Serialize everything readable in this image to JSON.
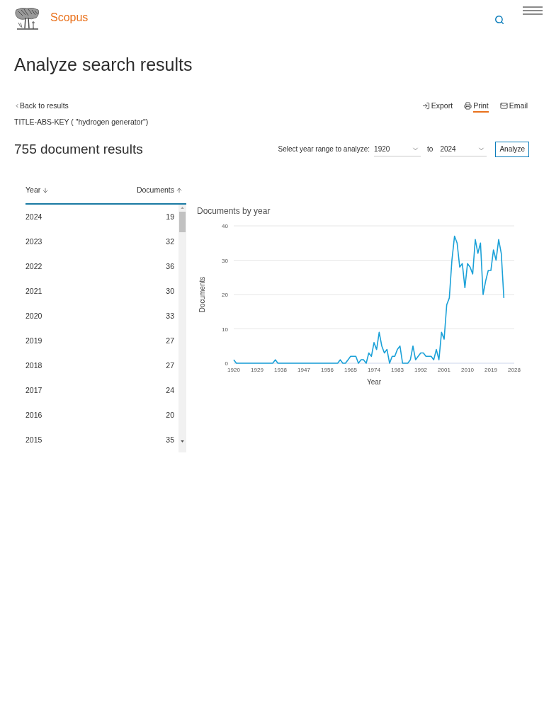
{
  "header": {
    "brand": "Scopus"
  },
  "page_title": "Analyze search results",
  "back_link": "Back to results",
  "actions": [
    {
      "label": "Export",
      "kind": "export",
      "focused": false
    },
    {
      "label": "Print",
      "kind": "print",
      "focused": true
    },
    {
      "label": "Email",
      "kind": "email",
      "focused": false
    }
  ],
  "query": "TITLE-ABS-KEY ( \"hydrogen generator\")",
  "results_count": "755 document results",
  "year_range": {
    "label": "Select year range to analyze:",
    "from": "1920",
    "separator": "to",
    "to": "2024",
    "button": "Analyze"
  },
  "table": {
    "columns": [
      {
        "label": "Year",
        "descending": true
      },
      {
        "label": "Documents",
        "descending": false
      }
    ],
    "rows": [
      {
        "year": "2024",
        "documents": "19"
      },
      {
        "year": "2023",
        "documents": "32"
      },
      {
        "year": "2022",
        "documents": "36"
      },
      {
        "year": "2021",
        "documents": "30"
      },
      {
        "year": "2020",
        "documents": "33"
      },
      {
        "year": "2019",
        "documents": "27"
      },
      {
        "year": "2018",
        "documents": "27"
      },
      {
        "year": "2017",
        "documents": "24"
      },
      {
        "year": "2016",
        "documents": "20"
      },
      {
        "year": "2015",
        "documents": "35"
      }
    ]
  },
  "chart": {
    "chart_data": {
      "type": "line",
      "title": "Documents by year",
      "xlabel": "Year",
      "ylabel": "Documents",
      "grid": true,
      "x": [
        1920,
        1921,
        1922,
        1923,
        1924,
        1925,
        1926,
        1927,
        1928,
        1929,
        1930,
        1931,
        1932,
        1933,
        1934,
        1935,
        1936,
        1937,
        1938,
        1939,
        1940,
        1941,
        1942,
        1943,
        1944,
        1945,
        1946,
        1947,
        1948,
        1949,
        1950,
        1951,
        1952,
        1953,
        1954,
        1955,
        1956,
        1957,
        1958,
        1959,
        1960,
        1961,
        1962,
        1963,
        1964,
        1965,
        1966,
        1967,
        1968,
        1969,
        1970,
        1971,
        1972,
        1973,
        1974,
        1975,
        1976,
        1977,
        1978,
        1979,
        1980,
        1981,
        1982,
        1983,
        1984,
        1985,
        1986,
        1987,
        1988,
        1989,
        1990,
        1991,
        1992,
        1993,
        1994,
        1995,
        1996,
        1997,
        1998,
        1999,
        2000,
        2001,
        2002,
        2003,
        2004,
        2005,
        2006,
        2007,
        2008,
        2009,
        2010,
        2011,
        2012,
        2013,
        2014,
        2015,
        2016,
        2017,
        2018,
        2019,
        2020,
        2021,
        2022,
        2023,
        2024
      ],
      "series": [
        {
          "color": "#1ba1d8",
          "values": [
            1,
            0,
            0,
            0,
            0,
            0,
            0,
            0,
            0,
            0,
            0,
            0,
            0,
            0,
            0,
            0,
            1,
            0,
            0,
            0,
            0,
            0,
            0,
            0,
            0,
            0,
            0,
            0,
            0,
            0,
            0,
            0,
            0,
            0,
            0,
            0,
            0,
            0,
            0,
            0,
            0,
            1,
            0,
            0,
            1,
            2,
            2,
            2,
            0,
            1,
            1,
            0,
            3,
            2,
            6,
            4,
            9,
            5,
            3,
            4,
            0,
            2,
            2,
            4,
            5,
            0,
            0,
            0,
            1,
            5,
            1,
            2,
            3,
            3,
            2,
            2,
            2,
            1,
            4,
            1,
            9,
            7,
            17,
            19,
            30,
            37,
            35,
            28,
            29,
            22,
            29,
            28,
            26,
            36,
            32,
            35,
            20,
            24,
            27,
            27,
            33,
            30,
            36,
            32,
            19
          ]
        }
      ],
      "xlim": [
        1920,
        2028
      ],
      "ylim": [
        0,
        40
      ],
      "xticks": [
        1920,
        1929,
        1938,
        1947,
        1956,
        1965,
        1974,
        1983,
        1992,
        2001,
        2010,
        2019,
        2028
      ],
      "yticks": [
        0,
        10,
        20,
        30,
        40
      ]
    }
  }
}
